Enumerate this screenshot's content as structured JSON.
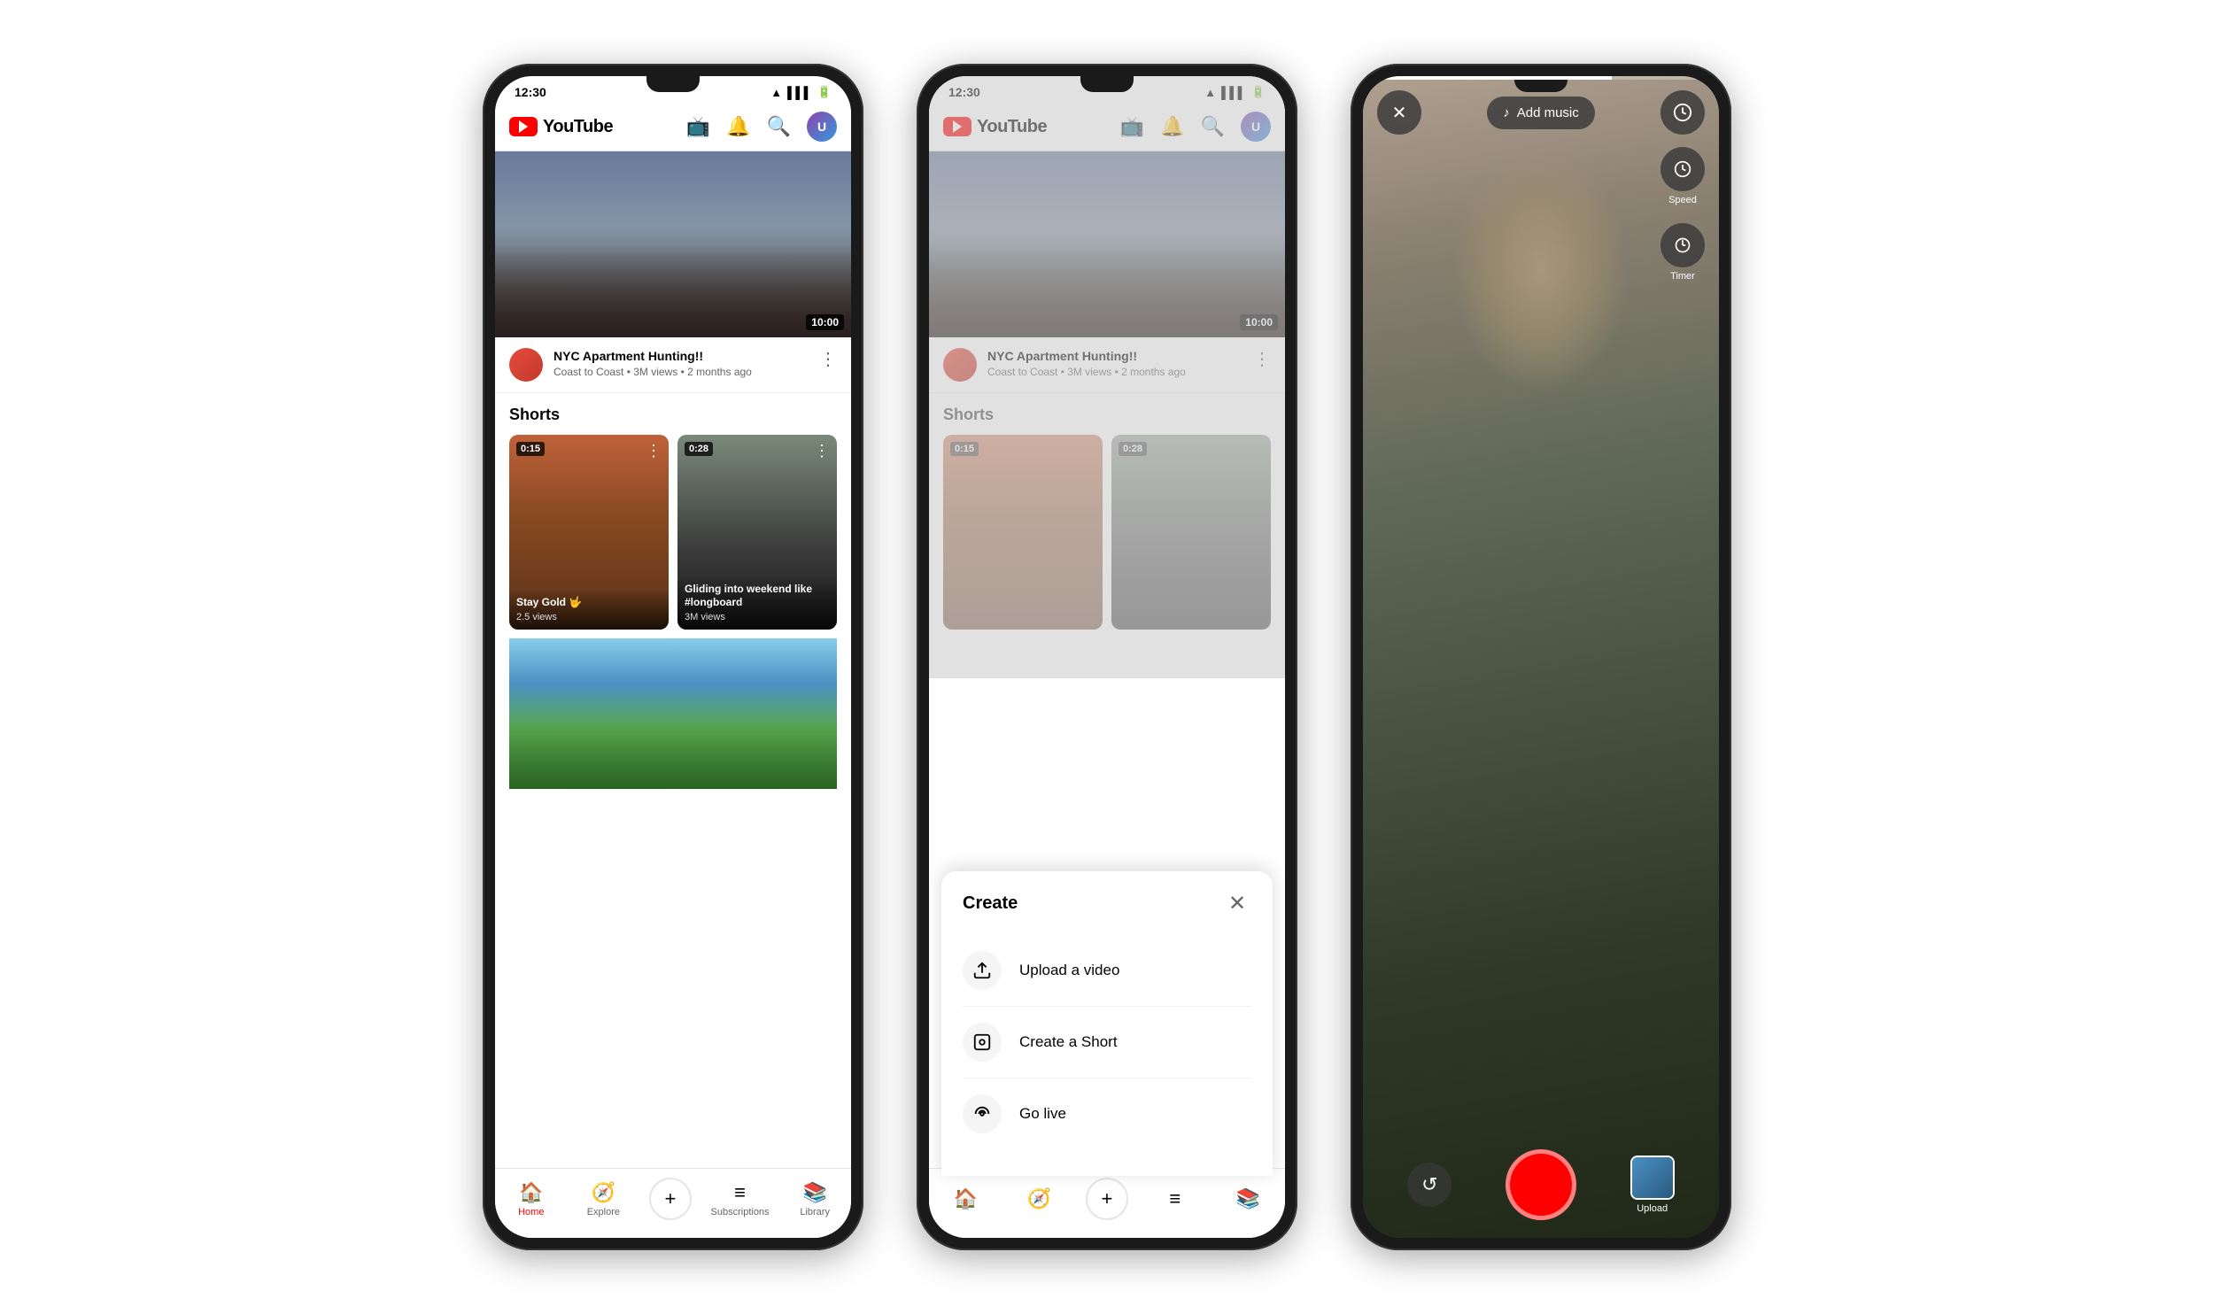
{
  "phone1": {
    "status_time": "12:30",
    "logo_text": "YouTube",
    "header_icons": [
      "cast",
      "bell",
      "search",
      "avatar"
    ],
    "video": {
      "duration": "10:00",
      "title": "NYC Apartment Hunting!!",
      "subtitle": "Coast to Coast • 3M views • 2 months ago"
    },
    "shorts_heading": "Shorts",
    "short1": {
      "duration": "0:15",
      "title": "Stay Gold 🤟",
      "views": "2.5 views"
    },
    "short2": {
      "duration": "0:28",
      "title": "Gliding into weekend like #longboard",
      "views": "3M views"
    },
    "nav": {
      "home": "Home",
      "explore": "Explore",
      "create": "+",
      "subscriptions": "Subscriptions",
      "library": "Library"
    }
  },
  "phone2": {
    "status_time": "12:30",
    "logo_text": "YouTube",
    "video": {
      "duration": "10:00",
      "title": "NYC Apartment Hunting!!",
      "subtitle": "Coast to Coast • 3M views • 2 months ago"
    },
    "shorts_heading": "Shorts",
    "short1": {
      "duration": "0:15"
    },
    "short2": {
      "duration": "0:28"
    },
    "modal": {
      "title": "Create",
      "close": "✕",
      "items": [
        {
          "icon": "⬆",
          "label": "Upload a video"
        },
        {
          "icon": "⬜",
          "label": "Create a Short"
        },
        {
          "icon": "📡",
          "label": "Go live"
        }
      ]
    }
  },
  "phone3": {
    "add_music_label": "Add music",
    "speed_label": "Speed",
    "timer_label": "Timer",
    "upload_label": "Upload",
    "progress_width": "70"
  }
}
